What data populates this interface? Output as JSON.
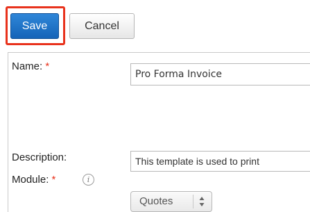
{
  "toolbar": {
    "save_label": "Save",
    "cancel_label": "Cancel"
  },
  "form": {
    "name_label": "Name:",
    "name_required_marker": "*",
    "name_value": "Pro Forma Invoice",
    "description_label": "Description:",
    "description_value": "This template is used to print",
    "module_label": "Module:",
    "module_required_marker": "*",
    "module_info_icon": "i",
    "module_selected": "Quotes"
  },
  "colors": {
    "primary_button": "#1f74c9",
    "highlight_border": "#e8321c",
    "required_marker": "#e8321c"
  },
  "icons": {
    "info": "info-icon",
    "select_arrows": "updown-arrows-icon"
  }
}
